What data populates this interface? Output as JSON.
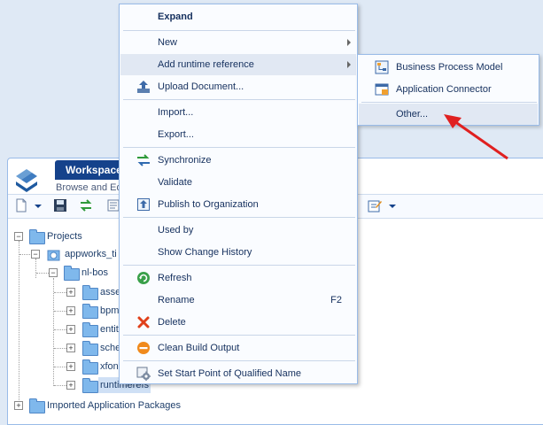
{
  "workspace": {
    "tab_title": "Workspace",
    "subtitle": "Browse and Ed"
  },
  "tree": {
    "items": [
      {
        "label": "Projects",
        "expander": "−"
      },
      {
        "label": "appworks_ti",
        "expander": "−"
      },
      {
        "label": "nl-bos",
        "expander": "−"
      },
      {
        "label": "asse",
        "expander": "+"
      },
      {
        "label": "bpm",
        "expander": "+"
      },
      {
        "label": "entit",
        "expander": "+"
      },
      {
        "label": "sche",
        "expander": "+"
      },
      {
        "label": "xfon",
        "expander": "+"
      },
      {
        "label": "runtimerefs",
        "expander": "+"
      },
      {
        "label": "Imported Application Packages",
        "expander": "+"
      }
    ]
  },
  "context_menu": {
    "expand": "Expand",
    "new": "New",
    "add_runtime_reference": "Add runtime reference",
    "upload_document": "Upload Document...",
    "import": "Import...",
    "export": "Export...",
    "synchronize": "Synchronize",
    "validate": "Validate",
    "publish": "Publish to Organization",
    "used_by": "Used by",
    "show_change_history": "Show Change History",
    "refresh": "Refresh",
    "rename": "Rename",
    "rename_shortcut": "F2",
    "delete": "Delete",
    "clean_build_output": "Clean Build Output",
    "set_start_point": "Set Start Point of Qualified Name"
  },
  "submenu": {
    "business_process_model": "Business Process Model",
    "application_connector": "Application Connector",
    "other": "Other..."
  },
  "colors": {
    "accent": "#15428b",
    "highlight": "#e1e8f3",
    "annotation_arrow": "#e02020"
  }
}
